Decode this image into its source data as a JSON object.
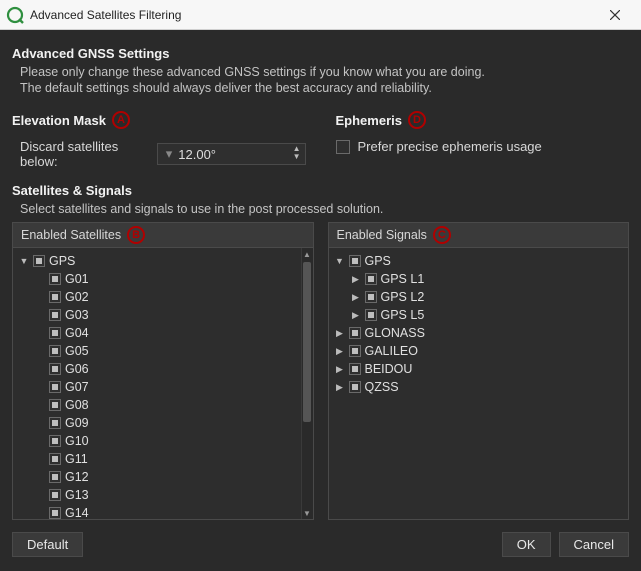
{
  "window": {
    "title": "Advanced Satellites Filtering"
  },
  "gnss": {
    "section_title": "Advanced GNSS Settings",
    "desc1": "Please only change these advanced GNSS settings if you know what you are doing.",
    "desc2": "The default settings should always deliver the best accuracy and reliability."
  },
  "elevation": {
    "title": "Elevation Mask",
    "badge": "A",
    "discard_label": "Discard satellites below:",
    "value": "12.00°"
  },
  "ephemeris": {
    "title": "Ephemeris",
    "badge": "D",
    "checkbox_label": "Prefer precise ephemeris usage"
  },
  "satsig": {
    "title": "Satellites & Signals",
    "desc": "Select satellites and signals to use in the post processed solution."
  },
  "tree_left": {
    "header": "Enabled Satellites",
    "badge": "B",
    "root": "GPS",
    "items": [
      "G01",
      "G02",
      "G03",
      "G04",
      "G05",
      "G06",
      "G07",
      "G08",
      "G09",
      "G10",
      "G11",
      "G12",
      "G13",
      "G14"
    ]
  },
  "tree_right": {
    "header": "Enabled Signals",
    "badge": "C",
    "gps": {
      "label": "GPS",
      "children": [
        "GPS L1",
        "GPS L2",
        "GPS L5"
      ]
    },
    "others": [
      "GLONASS",
      "GALILEO",
      "BEIDOU",
      "QZSS"
    ]
  },
  "buttons": {
    "default": "Default",
    "ok": "OK",
    "cancel": "Cancel"
  }
}
